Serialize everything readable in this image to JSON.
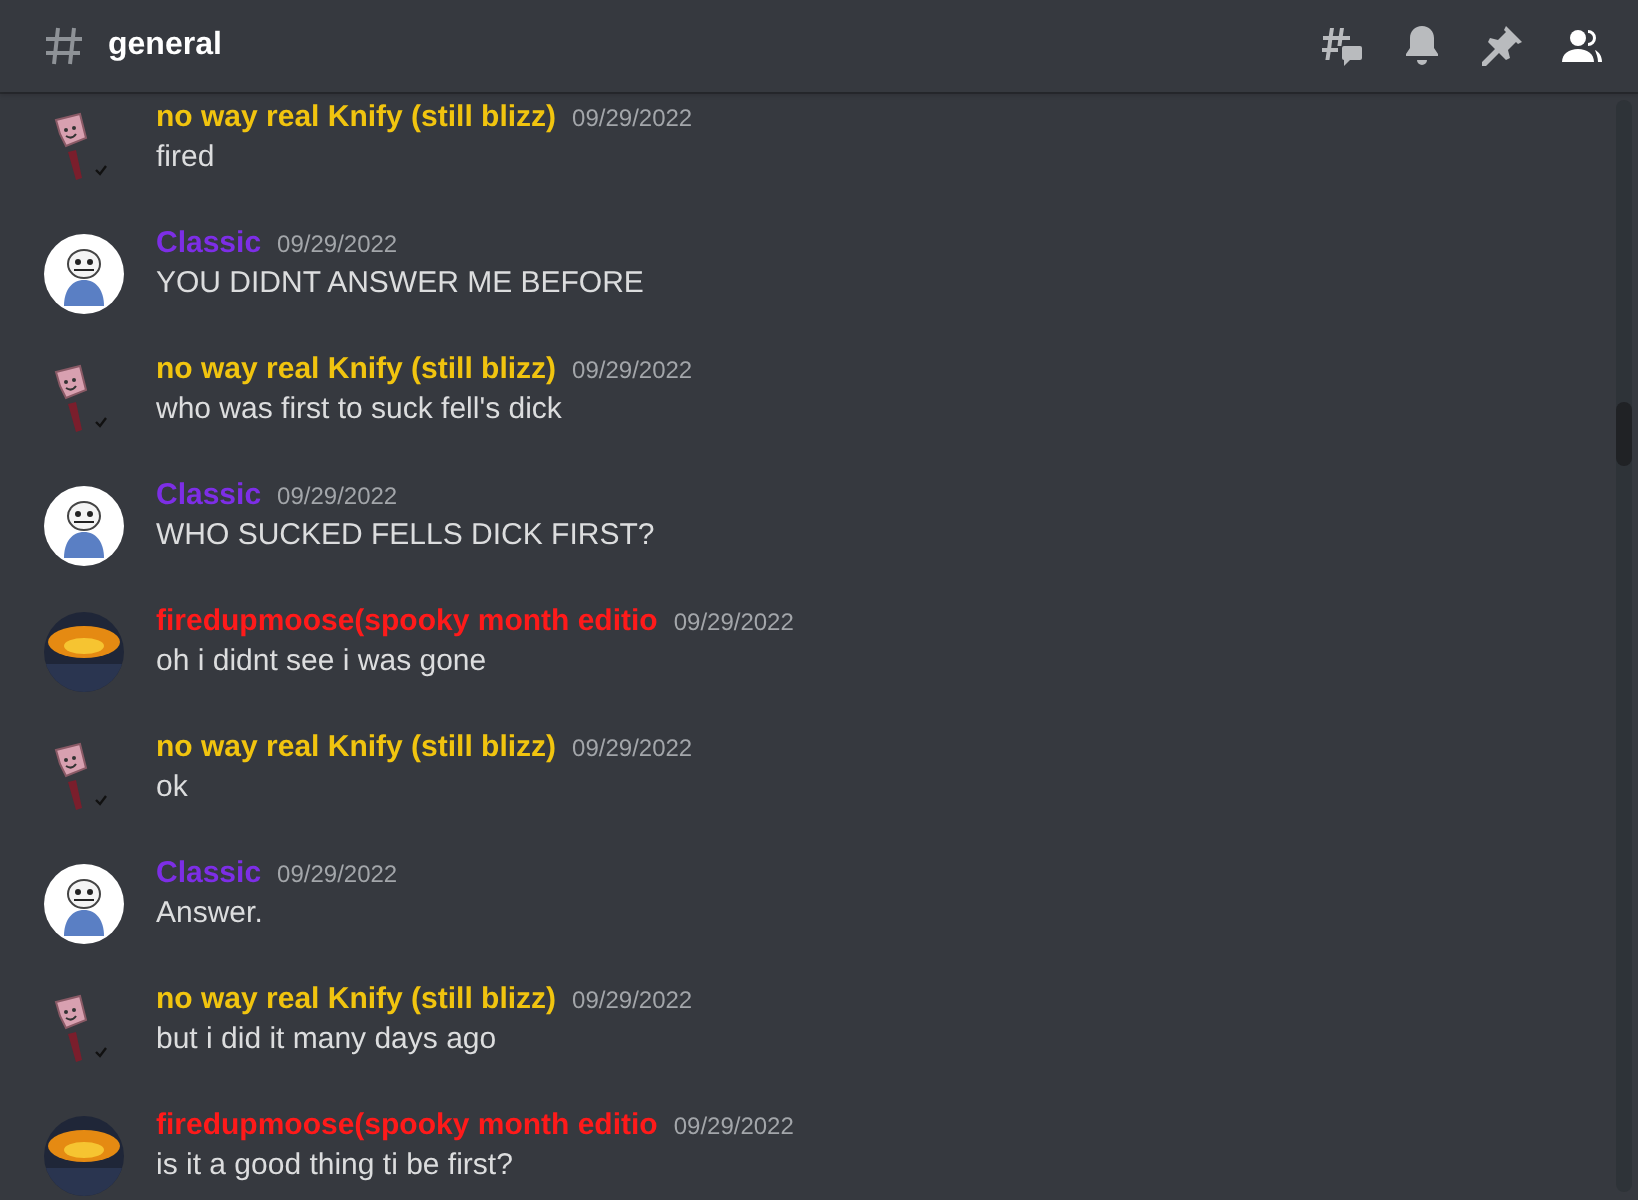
{
  "channel": {
    "name": "general"
  },
  "messages": [
    {
      "author": "no way real Knify (still blizz)",
      "color": "#f1c40f",
      "kind": "knife",
      "time": "09/29/2022",
      "text": "fired"
    },
    {
      "author": "Classic",
      "color": "#7d2ee6",
      "kind": "skeleton",
      "time": "09/29/2022",
      "text": "YOU DIDNT ANSWER ME BEFORE"
    },
    {
      "author": "no way real Knify (still blizz)",
      "color": "#f1c40f",
      "kind": "knife",
      "time": "09/29/2022",
      "text": "who was first to suck fell's dick"
    },
    {
      "author": "Classic",
      "color": "#7d2ee6",
      "kind": "skeleton",
      "time": "09/29/2022",
      "text": "WHO SUCKED FELLS DICK FIRST?"
    },
    {
      "author": "firedupmoose(spooky month editio",
      "color": "#ff1a1a",
      "kind": "fire",
      "time": "09/29/2022",
      "text": "oh i didnt see i was gone"
    },
    {
      "author": "no way real Knify (still blizz)",
      "color": "#f1c40f",
      "kind": "knife",
      "time": "09/29/2022",
      "text": "ok"
    },
    {
      "author": "Classic",
      "color": "#7d2ee6",
      "kind": "skeleton",
      "time": "09/29/2022",
      "text": "Answer."
    },
    {
      "author": "no way real Knify (still blizz)",
      "color": "#f1c40f",
      "kind": "knife",
      "time": "09/29/2022",
      "text": "but i did it many days ago"
    },
    {
      "author": "firedupmoose(spooky month editio",
      "color": "#ff1a1a",
      "kind": "fire",
      "time": "09/29/2022",
      "text": "is it a good thing ti be first?"
    }
  ]
}
